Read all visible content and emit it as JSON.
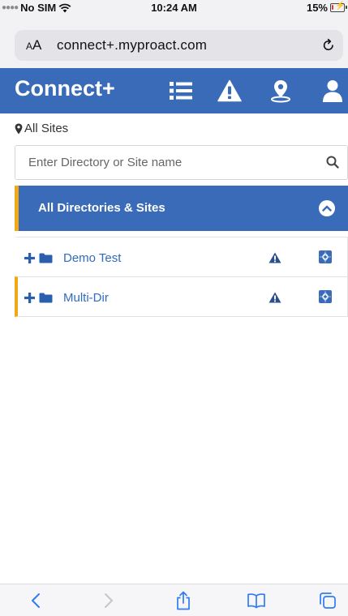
{
  "status_bar": {
    "carrier": "No SIM",
    "time": "10:24 AM",
    "battery_percent": "15%",
    "battery_level": 0.15,
    "battery_color": "#e53935"
  },
  "browser": {
    "aa_label_small": "A",
    "aa_label_large": "A",
    "url": "connect+.myproact.com"
  },
  "navbar": {
    "brand": "Connect+",
    "icons": [
      "list-icon",
      "alert-triangle-icon",
      "map-pin-icon",
      "user-icon"
    ],
    "color": "#3a6bb8"
  },
  "breadcrumb": {
    "label": "All Sites"
  },
  "search": {
    "placeholder": "Enter Directory or Site name",
    "value": ""
  },
  "directories": {
    "header": "All Directories & Sites",
    "accent_color": "#f0a818",
    "items": [
      {
        "name": "Demo Test",
        "accent": false
      },
      {
        "name": "Multi-Dir",
        "accent": true
      }
    ]
  },
  "toolbar": {
    "icons": [
      "back-icon",
      "forward-icon",
      "share-icon",
      "bookmarks-icon",
      "tabs-icon"
    ]
  }
}
